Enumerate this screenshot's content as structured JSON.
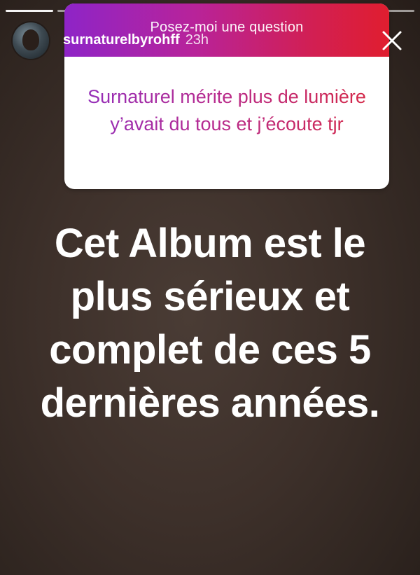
{
  "story": {
    "progress_segments": 8,
    "progress_done": 1
  },
  "header": {
    "username": "surnaturelbyrohff",
    "time": "23h",
    "close_icon": "close-icon"
  },
  "question_card": {
    "title": "Posez-moi une question",
    "answer": "Surnaturel mérite plus de lumière y’avait du tous et j’écoute tjr",
    "gradient_start": "#8e24c7",
    "gradient_end": "#e01e2f"
  },
  "main_text": "Cet Album est le plus sérieux et complet de ces 5 dernières années."
}
